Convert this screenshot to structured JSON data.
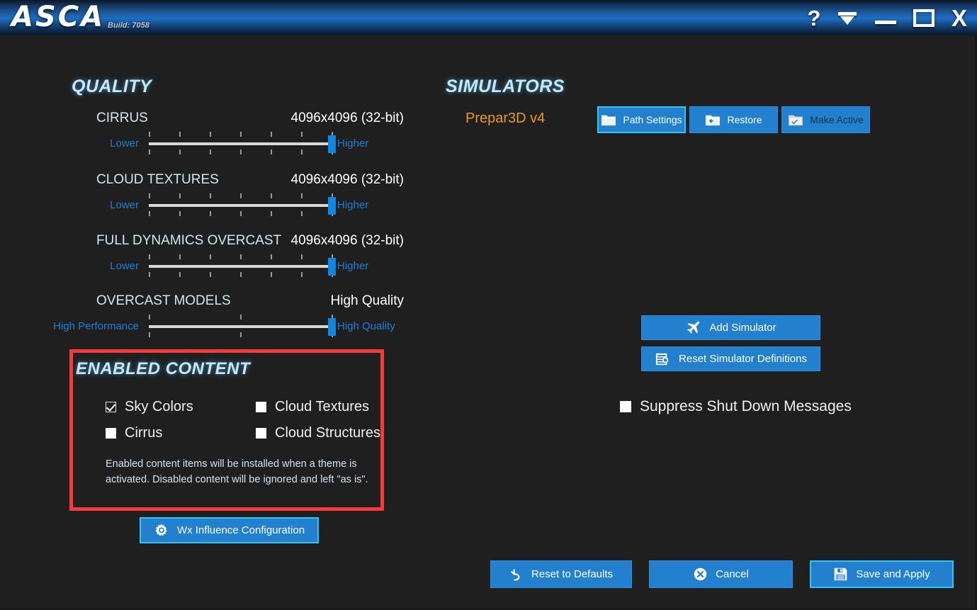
{
  "window": {
    "app_name": "ASCA",
    "build_label": "Build: 7058",
    "controls": {
      "help": "?",
      "menu": "menu-chevron",
      "minimize": "minimize",
      "maximize": "maximize",
      "close": "X"
    }
  },
  "quality": {
    "header": "QUALITY",
    "sliders": [
      {
        "label": "CIRRUS",
        "value": "4096x4096 (32-bit)",
        "min_label": "Lower",
        "max_label": "Higher",
        "ticks": 7,
        "position": 100
      },
      {
        "label": "CLOUD TEXTURES",
        "value": "4096x4096 (32-bit)",
        "min_label": "Lower",
        "max_label": "Higher",
        "ticks": 7,
        "position": 100
      },
      {
        "label": "FULL DYNAMICS OVERCAST",
        "value": "4096x4096 (32-bit)",
        "min_label": "Lower",
        "max_label": "Higher",
        "ticks": 7,
        "position": 100
      },
      {
        "label": "OVERCAST MODELS",
        "value": "High Quality",
        "min_label": "High Performance",
        "max_label": "High Quality",
        "ticks": 3,
        "position": 100
      }
    ]
  },
  "enabled_content": {
    "header": "ENABLED CONTENT",
    "checkboxes": [
      {
        "label": "Sky Colors",
        "checked": true
      },
      {
        "label": "Cloud Textures",
        "checked": false
      },
      {
        "label": "Cirrus",
        "checked": false
      },
      {
        "label": "Cloud Structures",
        "checked": false
      }
    ],
    "note": "Enabled content items will be installed when a theme is activated.  Disabled content will be ignored and left \"as is\"."
  },
  "wx_button": {
    "label": "Wx Influence Configuration",
    "icon": "gear-icon"
  },
  "simulators": {
    "header": "SIMULATORS",
    "active_simulator": "Prepar3D v4",
    "row_buttons": [
      {
        "label": "Path Settings",
        "icon": "folder-icon"
      },
      {
        "label": "Restore",
        "icon": "folder-restore-icon"
      },
      {
        "label": "Make Active",
        "icon": "folder-check-icon"
      }
    ],
    "stack_buttons": [
      {
        "label": "Add Simulator",
        "icon": "airplane-icon"
      },
      {
        "label": "Reset Simulator Definitions",
        "icon": "list-reset-icon"
      }
    ],
    "suppress": {
      "label": "Suppress Shut Down Messages",
      "checked": false
    }
  },
  "footer": {
    "buttons": [
      {
        "label": "Reset to Defaults",
        "icon": "undo-icon"
      },
      {
        "label": "Cancel",
        "icon": "close-circle-icon"
      },
      {
        "label": "Save and Apply",
        "icon": "floppy-icon"
      }
    ]
  },
  "colors": {
    "accent_blue": "#2380ce",
    "highlight_red": "#f93a3a",
    "header_cyan": "#c7e9f7",
    "sim_orange": "#eb9a1d",
    "slider_thumb": "#1186e0"
  }
}
